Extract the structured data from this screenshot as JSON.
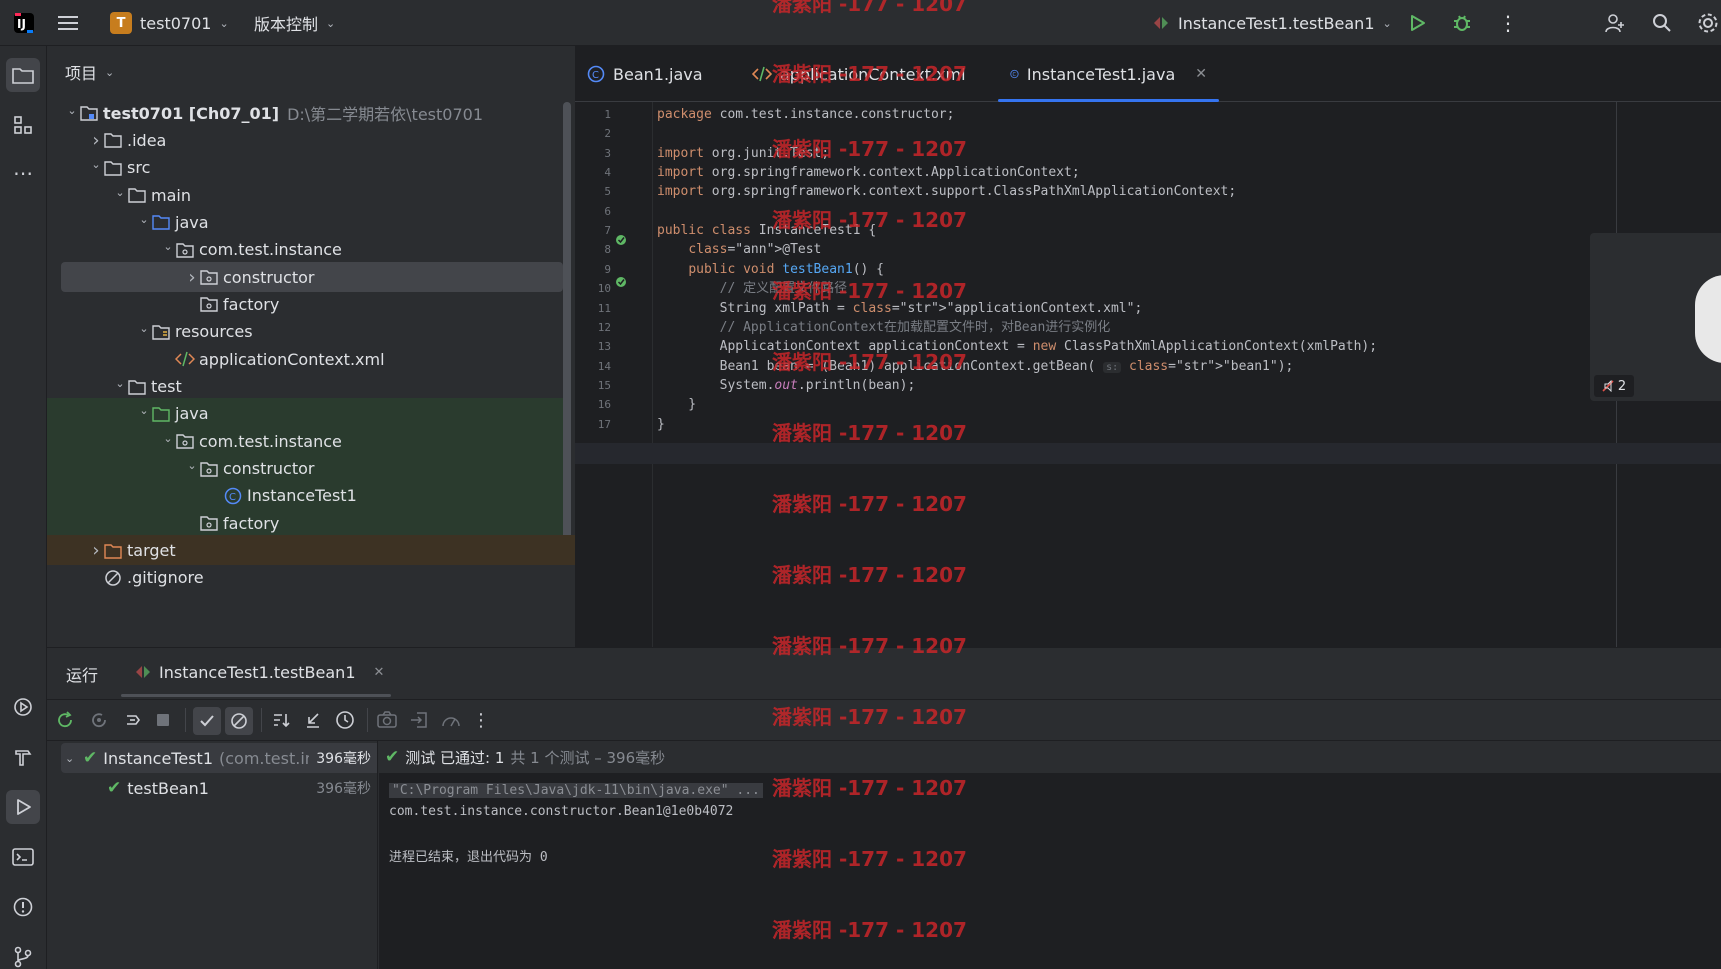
{
  "titlebar": {
    "project_initial": "T",
    "project_name": "test0701",
    "vcs_label": "版本控制",
    "run_config": "InstanceTest1.testBean1"
  },
  "project_panel": {
    "header": "项目",
    "root_name": "test0701 [Ch07_01]",
    "root_path": "D:\\第二学期若依\\test0701",
    "items": [
      {
        "label": "test0701 [Ch07_01]"
      },
      {
        "label": ".idea"
      },
      {
        "label": "src"
      },
      {
        "label": "main"
      },
      {
        "label": "java"
      },
      {
        "label": "com.test.instance"
      },
      {
        "label": "constructor"
      },
      {
        "label": "factory"
      },
      {
        "label": "resources"
      },
      {
        "label": "applicationContext.xml"
      },
      {
        "label": "test"
      },
      {
        "label": "java"
      },
      {
        "label": "com.test.instance"
      },
      {
        "label": "constructor"
      },
      {
        "label": "InstanceTest1"
      },
      {
        "label": "factory"
      },
      {
        "label": "target"
      },
      {
        "label": ".gitignore"
      }
    ]
  },
  "editor": {
    "tabs": [
      {
        "label": "Bean1.java"
      },
      {
        "label": "applicationContext.xml"
      },
      {
        "label": "InstanceTest1.java"
      }
    ],
    "lines": [
      {
        "num": "1",
        "text": "package com.test.instance.constructor;"
      },
      {
        "num": "2",
        "text": ""
      },
      {
        "num": "3",
        "text": "import org.junit.Test;"
      },
      {
        "num": "4",
        "text": "import org.springframework.context.ApplicationContext;"
      },
      {
        "num": "5",
        "text": "import org.springframework.context.support.ClassPathXmlApplicationContext;"
      },
      {
        "num": "6",
        "text": ""
      },
      {
        "num": "7",
        "text": "public class InstanceTest1 {"
      },
      {
        "num": "8",
        "text": "    @Test"
      },
      {
        "num": "9",
        "text": "    public void testBean1() {"
      },
      {
        "num": "10",
        "text": "        // 定义配置文件路径"
      },
      {
        "num": "11",
        "text": "        String xmlPath = \"applicationContext.xml\";"
      },
      {
        "num": "12",
        "text": "        // ApplicationContext在加载配置文件时，对Bean进行实例化"
      },
      {
        "num": "13",
        "text": "        ApplicationContext applicationContext = new ClassPathXmlApplicationContext(xmlPath);"
      },
      {
        "num": "14",
        "text": "        Bean1 bean = (Bean1) applicationContext.getBean( s: \"bean1\");"
      },
      {
        "num": "15",
        "text": "        System.out.println(bean);"
      },
      {
        "num": "16",
        "text": "    }"
      },
      {
        "num": "17",
        "text": "}"
      }
    ],
    "inlay_hint": "s:",
    "side_badge": "2"
  },
  "run_panel": {
    "title": "运行",
    "tab_label": "InstanceTest1.testBean1",
    "tests": [
      {
        "name": "InstanceTest1",
        "pkg": "(com.test.inst",
        "time": "396毫秒"
      },
      {
        "name": "testBean1",
        "pkg": "",
        "time": "396毫秒"
      }
    ],
    "summary_passed": "测试 已通过: 1",
    "summary_rest": "共 1 个测试 – 396毫秒",
    "console": [
      "\"C:\\Program Files\\Java\\jdk-11\\bin\\java.exe\" ...",
      "com.test.instance.constructor.Bean1@1e0b4072",
      "",
      "进程已结束，退出代码为 0"
    ]
  },
  "watermark": "潘紫阳 -177 - 1207",
  "colors": {
    "accent": "#3574f0",
    "pass_green": "#5fb865",
    "watermark_red": "#c8262a",
    "selected_row": "#43454a",
    "test_tree_green": "#2a3b2e",
    "target_orange": "#3d3223"
  }
}
